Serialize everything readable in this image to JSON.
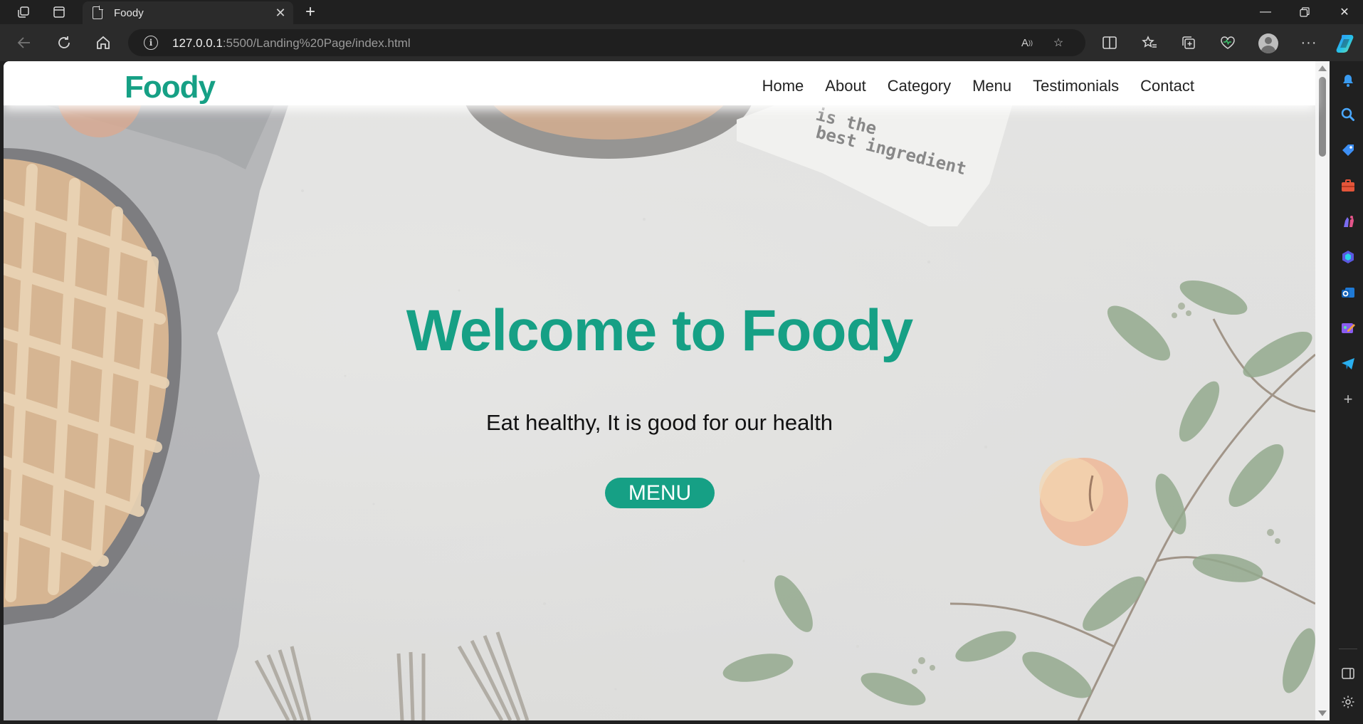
{
  "browser": {
    "tab_title": "Foody",
    "url_host": "127.0.0.1",
    "url_rest": ":5500/Landing%20Page/index.html"
  },
  "site": {
    "logo": "Foody",
    "nav": [
      "Home",
      "About",
      "Category",
      "Menu",
      "Testimonials",
      "Contact"
    ],
    "hero_title": "Welcome to Foody",
    "hero_subtitle": "Eat healthy, It is good for our health",
    "menu_button": "MENU",
    "napkin_text_1": "is the",
    "napkin_text_2": "best ingredient"
  },
  "colors": {
    "brand": "#16a085",
    "browser_bg": "#202020",
    "toolbar_bg": "#2b2b2b"
  }
}
